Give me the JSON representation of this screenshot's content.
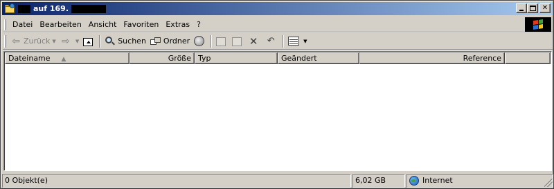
{
  "window": {
    "title": "auf 169."
  },
  "menubar": {
    "items": [
      {
        "label": "Datei"
      },
      {
        "label": "Bearbeiten"
      },
      {
        "label": "Ansicht"
      },
      {
        "label": "Favoriten"
      },
      {
        "label": "Extras"
      },
      {
        "label": "?"
      }
    ]
  },
  "toolbar": {
    "back_label": "Zurück",
    "search_label": "Suchen",
    "folders_label": "Ordner"
  },
  "listview": {
    "columns": [
      {
        "label": "Dateiname",
        "sort": "ascending"
      },
      {
        "label": "Größe"
      },
      {
        "label": "Typ"
      },
      {
        "label": "Geändert"
      },
      {
        "label": "Reference"
      }
    ],
    "rows": []
  },
  "statusbar": {
    "objects": "0 Objekt(e)",
    "size": "6,02 GB",
    "zone": "Internet"
  },
  "icons": {
    "window": "folder-globe-icon",
    "back": "back-arrow-icon",
    "forward": "forward-arrow-icon",
    "up": "up-folder-icon",
    "search": "search-icon",
    "folders": "folders-icon",
    "history": "history-icon",
    "move_to": "move-to-icon",
    "copy_to": "copy-to-icon",
    "delete": "delete-icon",
    "undo": "undo-icon",
    "views": "views-icon",
    "zone": "internet-globe-icon"
  }
}
